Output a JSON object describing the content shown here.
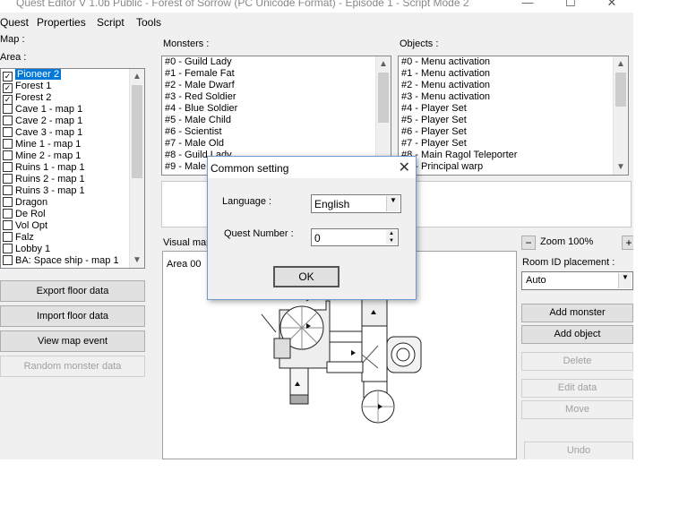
{
  "window": {
    "title": "Quest Editor V 1.0b Public - Forest of Sorrow (PC Unicode Format) - Episode 1 - Script Mode 2",
    "minimize": "—",
    "maximize": "☐",
    "close": "✕"
  },
  "menu": [
    "Quest",
    "Properties",
    "Script",
    "Tools"
  ],
  "left": {
    "map_label": "Map :",
    "area_label": "Area :",
    "areas": [
      {
        "label": "Pioneer 2",
        "checked": true,
        "selected": true
      },
      {
        "label": "Forest 1",
        "checked": true,
        "selected": false
      },
      {
        "label": "Forest 2",
        "checked": true,
        "selected": false
      },
      {
        "label": "Cave 1 - map 1",
        "checked": false,
        "selected": false
      },
      {
        "label": "Cave 2 - map 1",
        "checked": false,
        "selected": false
      },
      {
        "label": "Cave 3 - map 1",
        "checked": false,
        "selected": false
      },
      {
        "label": "Mine 1 - map 1",
        "checked": false,
        "selected": false
      },
      {
        "label": "Mine 2 - map 1",
        "checked": false,
        "selected": false
      },
      {
        "label": "Ruins 1 - map 1",
        "checked": false,
        "selected": false
      },
      {
        "label": "Ruins 2 - map 1",
        "checked": false,
        "selected": false
      },
      {
        "label": "Ruins 3 - map 1",
        "checked": false,
        "selected": false
      },
      {
        "label": "Dragon",
        "checked": false,
        "selected": false
      },
      {
        "label": "De Rol",
        "checked": false,
        "selected": false
      },
      {
        "label": "Vol Opt",
        "checked": false,
        "selected": false
      },
      {
        "label": "Falz",
        "checked": false,
        "selected": false
      },
      {
        "label": "Lobby 1",
        "checked": false,
        "selected": false
      },
      {
        "label": "BA: Space ship - map 1",
        "checked": false,
        "selected": false
      }
    ],
    "buttons": {
      "export": "Export floor data",
      "import": "Import floor data",
      "view_event": "View map event",
      "random_monster": "Random monster data"
    }
  },
  "monsters": {
    "label": "Monsters :",
    "items": [
      "#0 - Guild Lady",
      "#1 - Female Fat",
      "#2 - Male Dwarf",
      "#3 - Red Soldier",
      "#4 - Blue Soldier",
      "#5 - Male Child",
      "#6 - Scientist",
      "#7 - Male Old",
      "#8 - Guild Lady",
      "#9 - Male"
    ]
  },
  "objects": {
    "label": "Objects :",
    "items": [
      "#0 - Menu activation",
      "#1 - Menu activation",
      "#2 - Menu activation",
      "#3 - Menu activation",
      "#4 - Player Set",
      "#5 - Player Set",
      "#6 - Player Set",
      "#7 - Player Set",
      "#8 - Main Ragol Teleporter",
      "#9 - Principal warp"
    ]
  },
  "visual": {
    "label": "Visual map",
    "area_text": "Area 00"
  },
  "right": {
    "zoom_minus": "−",
    "zoom_text": "Zoom 100%",
    "zoom_plus": "+",
    "room_id_label": "Room ID placement :",
    "room_id_value": "Auto",
    "buttons": {
      "add_monster": "Add monster",
      "add_object": "Add object",
      "delete": "Delete",
      "edit_data": "Edit data",
      "move": "Move",
      "undo": "Undo"
    }
  },
  "dialog": {
    "title": "Common setting",
    "close": "✕",
    "language_label": "Language :",
    "language_value": "English",
    "quest_number_label": "Quest Number :",
    "quest_number_value": "0",
    "ok": "OK"
  }
}
